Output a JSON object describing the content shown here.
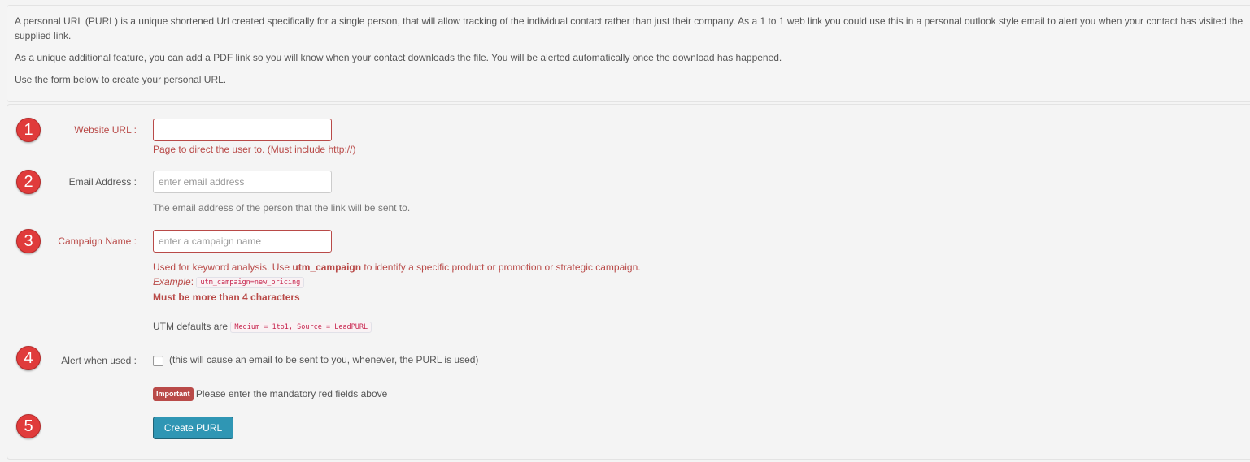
{
  "intro": {
    "paragraph1": "A personal URL (PURL) is a unique shortened Url created specifically for a single person, that will allow tracking of the individual contact rather than just their company. As a 1 to 1 web link you could use this in a personal outlook style email to alert you when your contact has visited the supplied link.",
    "paragraph2": "As a unique additional feature, you can add a PDF link so you will know when your contact downloads the file. You will be alerted automatically once the download has happened.",
    "paragraph3": "Use the form below to create your personal URL."
  },
  "steps": [
    "1",
    "2",
    "3",
    "4",
    "5"
  ],
  "form": {
    "website_url": {
      "label": "Website URL :",
      "value": "",
      "placeholder": "",
      "help": "Page to direct the user to. (Must include http://)"
    },
    "email": {
      "label": "Email Address :",
      "value": "",
      "placeholder": "enter email address",
      "help": "The email address of the person that the link will be sent to."
    },
    "campaign": {
      "label": "Campaign Name :",
      "value": "",
      "placeholder": "enter a campaign name",
      "help_prefix": "Used for keyword analysis. Use ",
      "help_keyword": "utm_campaign",
      "help_suffix": " to identify a specific product or promotion or strategic campaign.",
      "example_label": "Example",
      "example_colon": ":",
      "example_code": "utm_campaign=new_pricing",
      "validation": "Must be more than 4 characters"
    },
    "utm_defaults": {
      "text": "UTM defaults are",
      "code": "Medium = 1to1, Source = LeadPURL"
    },
    "alert": {
      "label": "Alert when used :",
      "checked": false,
      "text": "(this will cause an email to be sent to you, whenever, the PURL is used)"
    },
    "notice": {
      "badge": "Important",
      "text": "Please enter the mandatory red fields above"
    },
    "submit_label": "Create PURL"
  },
  "colors": {
    "error_red": "#b94a48",
    "step_red": "#e03b3b",
    "button_blue": "#2f96b4"
  }
}
